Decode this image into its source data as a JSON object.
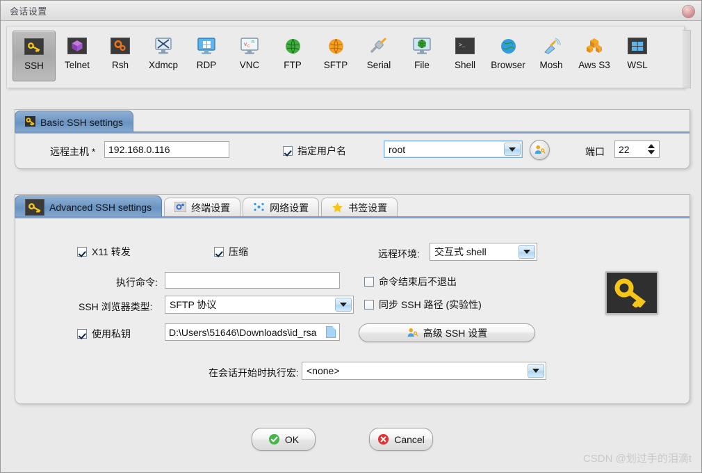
{
  "window": {
    "title": "会话设置",
    "close_icon": "close-orb-icon"
  },
  "protocol_toolbar": {
    "items": [
      {
        "label": "SSH",
        "icon": "key-icon",
        "selected": true
      },
      {
        "label": "Telnet",
        "icon": "cube-icon",
        "selected": false
      },
      {
        "label": "Rsh",
        "icon": "gears-icon",
        "selected": false
      },
      {
        "label": "Xdmcp",
        "icon": "x-monitor-icon",
        "selected": false
      },
      {
        "label": "RDP",
        "icon": "windows-monitor-icon",
        "selected": false
      },
      {
        "label": "VNC",
        "icon": "vnc-monitor-icon",
        "selected": false
      },
      {
        "label": "FTP",
        "icon": "green-globe-icon",
        "selected": false
      },
      {
        "label": "SFTP",
        "icon": "orange-globe-icon",
        "selected": false
      },
      {
        "label": "Serial",
        "icon": "plug-icon",
        "selected": false
      },
      {
        "label": "File",
        "icon": "file-monitor-icon",
        "selected": false
      },
      {
        "label": "Shell",
        "icon": "terminal-icon",
        "selected": false
      },
      {
        "label": "Browser",
        "icon": "blue-globe-icon",
        "selected": false
      },
      {
        "label": "Mosh",
        "icon": "satellite-icon",
        "selected": false
      },
      {
        "label": "Aws S3",
        "icon": "aws-boxes-icon",
        "selected": false
      },
      {
        "label": "WSL",
        "icon": "windows-icon",
        "selected": false
      }
    ]
  },
  "basic_ssh": {
    "tab_label": "Basic SSH settings",
    "tab_icon": "key-icon",
    "host_label": "远程主机 *",
    "host_value": "192.168.0.116",
    "specify_user_label": "指定用户名",
    "specify_user_checked": true,
    "username_value": "root",
    "user_button_icon": "user-key-icon",
    "port_label": "端口",
    "port_value": "22"
  },
  "advanced": {
    "tabs": [
      {
        "label": "Advanced SSH settings",
        "icon": "key-icon",
        "active": true
      },
      {
        "label": "终端设置",
        "icon": "terminal-gear-icon",
        "active": false
      },
      {
        "label": "网络设置",
        "icon": "network-dots-icon",
        "active": false
      },
      {
        "label": "书签设置",
        "icon": "star-icon",
        "active": false
      }
    ],
    "x11_label": "X11 转发",
    "x11_checked": true,
    "compression_label": "压缩",
    "compression_checked": true,
    "exec_cmd_label": "执行命令:",
    "exec_cmd_value": "",
    "exec_cmd_placeholder": "",
    "browser_type_label": "SSH 浏览器类型:",
    "browser_type_value": "SFTP 协议",
    "use_privkey_label": "使用私钥",
    "use_privkey_checked": true,
    "privkey_path": "D:\\Users\\51646\\Downloads\\id_rsa",
    "privkey_icon": "file-icon",
    "remote_env_label": "远程环境:",
    "remote_env_value": "交互式 shell",
    "no_exit_label": "命令结束后不退出",
    "no_exit_checked": false,
    "sync_path_label": "同步 SSH 路径 (实验性)",
    "sync_path_checked": false,
    "adv_ssh_button_label": "高级 SSH 设置",
    "adv_ssh_button_icon": "user-key-icon",
    "key_image_icon": "big-key-icon",
    "macro_label": "在会话开始时执行宏:",
    "macro_value": "<none>"
  },
  "footer": {
    "ok_label": "OK",
    "ok_icon": "green-check-icon",
    "cancel_label": "Cancel",
    "cancel_icon": "red-x-icon"
  },
  "watermark": {
    "text": "CSDN @划过手的泪滴t"
  }
}
